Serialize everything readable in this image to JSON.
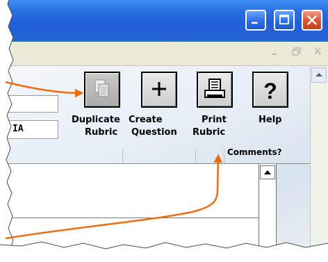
{
  "toolbar": {
    "duplicate_label_1": "Duplicate",
    "duplicate_label_2": "Rubric",
    "create_label_1": "Create",
    "create_label_2": "Question",
    "print_label_1": "Print",
    "print_label_2": "Rubric",
    "help_label": "Help"
  },
  "table": {
    "comments_header": "Comments?"
  },
  "field": {
    "value": "IA"
  },
  "colors": {
    "accent_arrow": "#f06a12",
    "title_bar": "#2665d6",
    "close_button": "#dc5736"
  },
  "icons": [
    "minimize-icon",
    "maximize-icon",
    "close-icon",
    "documents-icon",
    "plus-icon",
    "printer-icon",
    "question-icon",
    "scroll-up-arrow-icon"
  ]
}
